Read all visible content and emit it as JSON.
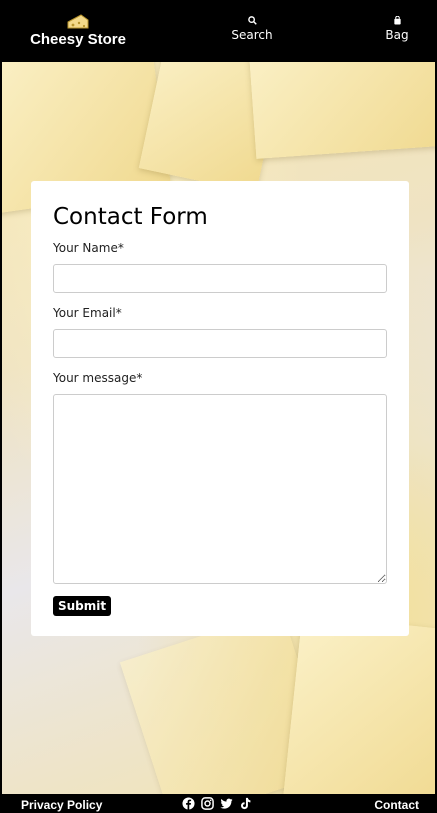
{
  "header": {
    "brand_name": "Cheesy Store",
    "brand_icon": "cheese-icon",
    "search_label": "Search",
    "search_icon": "search-icon",
    "bag_label": "Bag",
    "bag_icon": "bag-icon"
  },
  "form": {
    "title": "Contact Form",
    "name_label": "Your Name*",
    "name_value": "",
    "email_label": "Your Email*",
    "email_value": "",
    "message_label": "Your message*",
    "message_value": "",
    "submit_label": "Submit"
  },
  "footer": {
    "privacy_label": "Privacy Policy",
    "contact_label": "Contact",
    "social_icons": [
      "facebook-icon",
      "instagram-icon",
      "twitter-icon",
      "tiktok-icon"
    ]
  },
  "colors": {
    "header_bg": "#000000",
    "accent": "#f3d98a",
    "card_bg": "#ffffff"
  }
}
